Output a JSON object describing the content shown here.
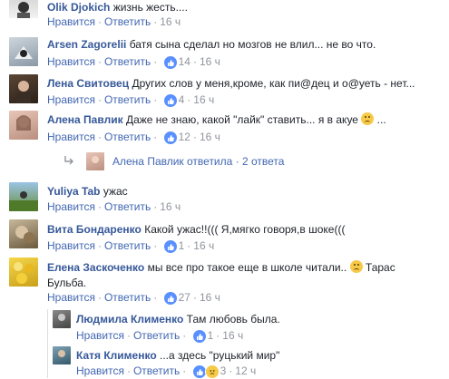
{
  "comments": [
    {
      "author": "Olik Djokich",
      "text": "жизнь жесть....",
      "like_label": "Нравится",
      "reply_label": "Ответить",
      "time": "16 ч"
    },
    {
      "author": "Arsen Zagorelii",
      "text": "батя сына сделал но мозгов не влил... не во что.",
      "like_label": "Нравится",
      "reply_label": "Ответить",
      "reactions": "14",
      "time": "16 ч"
    },
    {
      "author": "Лена Свитовец",
      "text": "Других слов у меня,кроме, как пи@дец и о@уеть - нет...",
      "like_label": "Нравится",
      "reply_label": "Ответить",
      "reactions": "4",
      "time": "16 ч"
    },
    {
      "author": "Алена Павлик",
      "text": "Даже не знаю, какой \"лайк\" ставить... я в акуе",
      "like_label": "Нравится",
      "reply_label": "Ответить",
      "reactions": "12",
      "time": "16 ч"
    },
    {
      "author": "Yuliya Tab",
      "text": "ужас",
      "like_label": "Нравится",
      "reply_label": "Ответить",
      "time": "16 ч"
    },
    {
      "author": "Вита Бондаренко",
      "text": "Какой ужас!!((( Я,мягко говоря,в шоке(((",
      "like_label": "Нравится",
      "reply_label": "Ответить",
      "reactions": "1",
      "time": "16 ч"
    },
    {
      "author": "Елена Заскоченко",
      "text": "мы все про такое еще в школе читали..",
      "text2_pre": "Тарас",
      "text2": "Бульба.",
      "like_label": "Нравится",
      "reply_label": "Ответить",
      "reactions": "27",
      "time": "16 ч"
    }
  ],
  "reply_summary": {
    "author": "Алена Павлик",
    "text": "ответила",
    "sep": "·",
    "count": "2 ответа"
  },
  "replies": [
    {
      "author": "Людмила Клименко",
      "text": "Там любовь была.",
      "like_label": "Нравится",
      "reply_label": "Ответить",
      "reactions": "1",
      "time": "16 ч"
    },
    {
      "author": "Катя Клименко",
      "text": "...а здесь \"руцький мир\"",
      "like_label": "Нравится",
      "reply_label": "Ответить",
      "reactions": "3",
      "time": "12 ч"
    }
  ],
  "sep": "·",
  "colors": {
    "link": "#365899",
    "action": "#4267b2",
    "meta": "#90949c",
    "like_blue": "#5890ff"
  },
  "icons": [
    "like-icon",
    "sad-icon",
    "reply-arrow-icon"
  ]
}
